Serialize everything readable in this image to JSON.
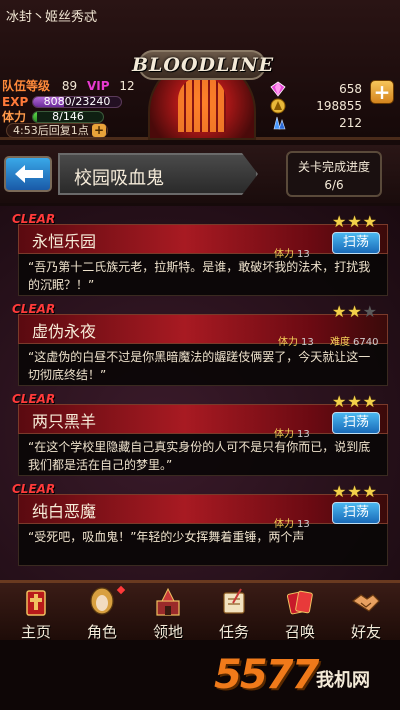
{
  "player": {
    "name": "冰封丶姬丝秀忒",
    "team_level_label": "队伍等级",
    "team_level": "89",
    "vip_label": "VIP",
    "vip_level": "12",
    "exp_label": "EXP",
    "exp_text": "8080/23240",
    "exp_fraction": 0.348,
    "stamina_label": "体力",
    "stamina_text": "8/146",
    "stamina_fraction": 0.055,
    "recover_text": "4:53后回复1点"
  },
  "logo": {
    "text": "BLOODLINE"
  },
  "resources": [
    {
      "icon": "gem-icon",
      "value": "658"
    },
    {
      "icon": "gold-coin-icon",
      "value": "198855"
    },
    {
      "icon": "crystal-icon",
      "value": "212"
    }
  ],
  "stage": {
    "title": "校园吸血鬼",
    "progress_label": "关卡完成进度",
    "progress_value": "6/6"
  },
  "cards": [
    {
      "clear": "CLEAR",
      "name": "永恒乐园",
      "stars": 3,
      "stamina_label": "体力",
      "stamina_cost": "13",
      "difficulty_label": "",
      "difficulty": "",
      "sweep_label": "扫荡",
      "description": "“吾乃第十二氏族元老，拉斯特。是谁，敢破坏我的法术，打扰我的沉眠？！”"
    },
    {
      "clear": "CLEAR",
      "name": "虚伪永夜",
      "stars": 2,
      "stamina_label": "体力",
      "stamina_cost": "13",
      "difficulty_label": "难度",
      "difficulty": "6740",
      "sweep_label": "",
      "description": "“这虚伪的白昼不过是你黑暗魔法的龌蹉伎俩罢了，今天就让这一切彻底终结！”"
    },
    {
      "clear": "CLEAR",
      "name": "两只黑羊",
      "stars": 3,
      "stamina_label": "体力",
      "stamina_cost": "13",
      "difficulty_label": "",
      "difficulty": "",
      "sweep_label": "扫荡",
      "description": "“在这个学校里隐藏自己真实身份的人可不是只有你而已，说到底我们都是活在自己的梦里。”"
    },
    {
      "clear": "CLEAR",
      "name": "纯白恶魔",
      "stars": 3,
      "stamina_label": "体力",
      "stamina_cost": "13",
      "difficulty_label": "",
      "difficulty": "",
      "sweep_label": "扫荡",
      "description": "“受死吧，吸血鬼！”年轻的少女挥舞着重锤，两个声"
    }
  ],
  "nav": [
    {
      "label": "主页",
      "icon": "home-icon"
    },
    {
      "label": "角色",
      "icon": "character-icon",
      "badge": true
    },
    {
      "label": "领地",
      "icon": "castle-icon"
    },
    {
      "label": "任务",
      "icon": "quest-scroll-icon"
    },
    {
      "label": "召唤",
      "icon": "summon-cards-icon"
    },
    {
      "label": "好友",
      "icon": "handshake-icon"
    }
  ],
  "watermark": {
    "number": "5577",
    "text": "我机网"
  },
  "colors": {
    "clear_red": "#ff3a3a",
    "sweep_blue": "#2a8ad8",
    "star_gold": "#f2d04a"
  }
}
